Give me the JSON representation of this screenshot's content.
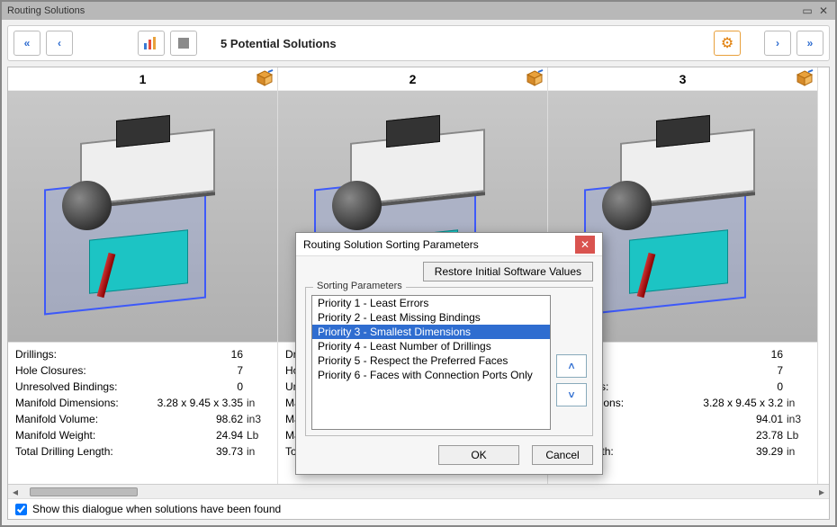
{
  "window": {
    "title": "Routing Solutions"
  },
  "toolbar": {
    "status": "5 Potential Solutions"
  },
  "footer": {
    "show_dialog_checked": true,
    "show_dialog_label": "Show this dialogue when solutions have been found"
  },
  "solutions": [
    {
      "index": "1",
      "stats": {
        "drillings_label": "Drillings:",
        "drillings": "16",
        "hole_closures_label": "Hole Closures:",
        "hole_closures": "7",
        "unresolved_label": "Unresolved Bindings:",
        "unresolved": "0",
        "dims_label": "Manifold Dimensions:",
        "dims": "3.28 x 9.45 x 3.35",
        "dims_unit": "in",
        "vol_label": "Manifold Volume:",
        "vol": "98.62",
        "vol_unit": "in3",
        "weight_label": "Manifold Weight:",
        "weight": "24.94",
        "weight_unit": "Lb",
        "tdl_label": "Total Drilling Length:",
        "tdl": "39.73",
        "tdl_unit": "in"
      }
    },
    {
      "index": "2",
      "stats": {
        "drillings_label": "Drillings:",
        "drillings": "",
        "hole_closures_label": "Hole Closures:",
        "hole_closures": "",
        "unresolved_label": "Unresolved Bindings:",
        "unresolved": "",
        "dims_label": "Manifold Dimensions:",
        "dims": "",
        "dims_unit": "",
        "vol_label": "Manifold Volume:",
        "vol": "",
        "vol_unit": "",
        "weight_label": "Manifold Weight:",
        "weight": "",
        "weight_unit": "",
        "tdl_label": "Total Drilling Length:",
        "tdl": "",
        "tdl_unit": ""
      }
    },
    {
      "index": "3",
      "stats": {
        "drillings_label": "Drillings:",
        "drillings": "16",
        "hole_closures_label": "Hole Closures:",
        "hole_closures": "7",
        "unresolved_label": "Unresolved Bindings:",
        "unresolved": "0",
        "dims_label": "Manifold Dimensions:",
        "dims": "3.28 x 9.45 x 3.2",
        "dims_unit": "in",
        "vol_label": "Manifold Volume:",
        "vol": "94.01",
        "vol_unit": "in3",
        "weight_label": "Manifold Weight:",
        "weight": "23.78",
        "weight_unit": "Lb",
        "tdl_label": "Total Drilling Length:",
        "tdl": "39.29",
        "tdl_unit": "in"
      }
    }
  ],
  "dialog": {
    "title": "Routing Solution Sorting Parameters",
    "restore_label": "Restore Initial Software Values",
    "group_label": "Sorting Parameters",
    "items": [
      "Priority 1 - Least Errors",
      "Priority 2 - Least Missing Bindings",
      "Priority 3 - Smallest Dimensions",
      "Priority 4 - Least Number of Drillings",
      "Priority 5 - Respect the Preferred Faces",
      "Priority 6 - Faces with Connection Ports Only"
    ],
    "selected_index": 2,
    "ok_label": "OK",
    "cancel_label": "Cancel"
  },
  "stats_partial_labels": {
    "closures": "sures:",
    "bindings": "d Bindings:",
    "dims": "d Dimensions:",
    "vol": "d Volume:",
    "weight": "d Weight:",
    "tdl": "lling Length:"
  }
}
